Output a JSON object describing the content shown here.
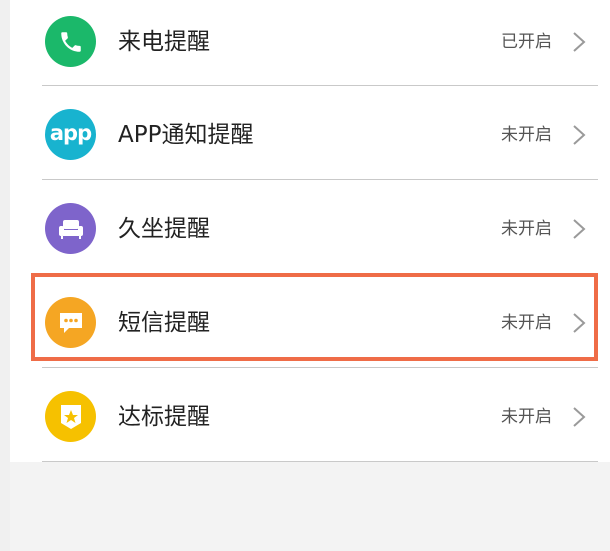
{
  "colors": {
    "call_icon_bg": "#1bb86a",
    "app_icon_bg": "#18b3cf",
    "sedentary_icon_bg": "#7e64cb",
    "sms_icon_bg": "#f5a623",
    "goal_icon_bg": "#f6c100",
    "highlight_border": "#ef6c47"
  },
  "reminders": [
    {
      "icon": "phone-icon",
      "label": "来电提醒",
      "status": "已开启"
    },
    {
      "icon": "app-icon",
      "icon_text": "app",
      "label": "APP通知提醒",
      "status": "未开启"
    },
    {
      "icon": "sofa-icon",
      "label": "久坐提醒",
      "status": "未开启"
    },
    {
      "icon": "message-icon",
      "label": "短信提醒",
      "status": "未开启"
    },
    {
      "icon": "star-badge-icon",
      "label": "达标提醒",
      "status": "未开启"
    }
  ]
}
